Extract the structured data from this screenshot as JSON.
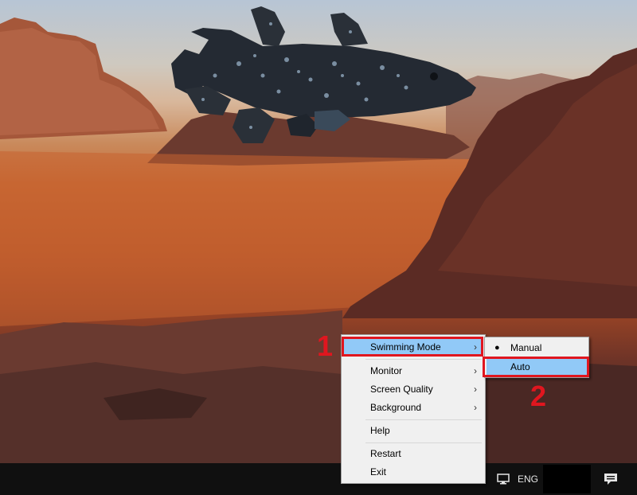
{
  "context_menu": {
    "items": [
      {
        "label": "Swimming Mode",
        "submenu": true
      },
      {
        "label": "Monitor",
        "submenu": true
      },
      {
        "label": "Screen Quality",
        "submenu": true
      },
      {
        "label": "Background",
        "submenu": true
      },
      {
        "label": "Help",
        "submenu": false
      },
      {
        "label": "Restart",
        "submenu": false
      },
      {
        "label": "Exit",
        "submenu": false
      }
    ],
    "highlighted": "Swimming Mode"
  },
  "submenu": {
    "items": [
      {
        "label": "Manual",
        "selected": true
      },
      {
        "label": "Auto",
        "selected": false
      }
    ],
    "highlighted": "Auto"
  },
  "annotations": {
    "step1": "1",
    "step2": "2",
    "color": "#e0161f"
  },
  "taskbar": {
    "language": "ENG",
    "hidden_icons": "^",
    "icons": [
      "network-icon",
      "notification-icon"
    ]
  },
  "colors": {
    "menu_background": "#f0f0f0",
    "menu_highlight": "#91c9f7",
    "taskbar": "#101010"
  }
}
